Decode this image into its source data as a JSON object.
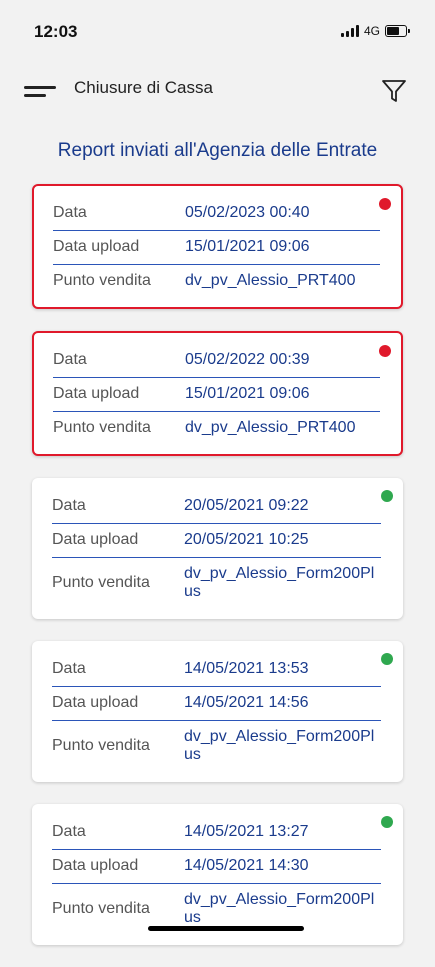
{
  "status": {
    "time": "12:03",
    "network": "4G"
  },
  "app_bar": {
    "title": "Chiusure di Cassa"
  },
  "section_title": "Report inviati all'Agenzia delle Entrate",
  "labels": {
    "data": "Data",
    "upload": "Data upload",
    "pv": "Punto vendita"
  },
  "colors": {
    "error": "#e0192b",
    "ok": "#2fa84f",
    "link": "#1a3b8c"
  },
  "cards": [
    {
      "status": "error",
      "data": "05/02/2023 00:40",
      "upload": "15/01/2021 09:06",
      "pv": "dv_pv_Alessio_PRT400"
    },
    {
      "status": "error",
      "data": "05/02/2022 00:39",
      "upload": "15/01/2021 09:06",
      "pv": "dv_pv_Alessio_PRT400"
    },
    {
      "status": "ok",
      "data": "20/05/2021 09:22",
      "upload": "20/05/2021 10:25",
      "pv": "dv_pv_Alessio_Form200Plus"
    },
    {
      "status": "ok",
      "data": "14/05/2021 13:53",
      "upload": "14/05/2021 14:56",
      "pv": "dv_pv_Alessio_Form200Plus"
    },
    {
      "status": "ok",
      "data": "14/05/2021 13:27",
      "upload": "14/05/2021 14:30",
      "pv": "dv_pv_Alessio_Form200Plus"
    }
  ]
}
